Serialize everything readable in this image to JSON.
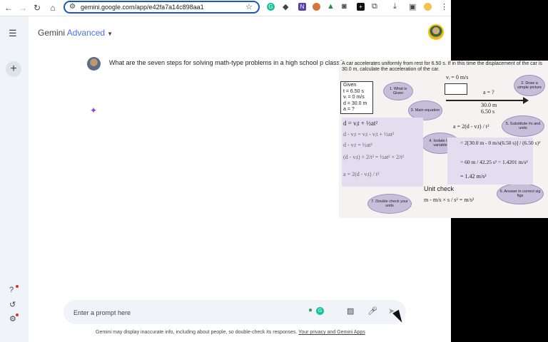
{
  "browser": {
    "url": "gemini.google.com/app/e42fa7a14c898aa1",
    "nav": {
      "back": "←",
      "forward": "→",
      "reload": "↻",
      "home": "⌂"
    },
    "icons": [
      "tune-icon",
      "bookmark-star-icon",
      "grammarly-extension-icon",
      "dropbox-icon",
      "onenote-icon",
      "avatar-extension-icon",
      "google-drive-icon",
      "camera-icon",
      "puzzle-extension-icon",
      "extensions-icon",
      "download-icon",
      "side-panel-icon",
      "profile-icon",
      "more-icon"
    ]
  },
  "app": {
    "brand_name": "Gemini",
    "brand_tier": "Advanced",
    "user_question": "What are the seven steps for solving math-type problems in a high school p class?",
    "prompt_placeholder": "Enter a prompt here",
    "disclaimer": "Gemini may display inaccurate info, including about people, so double-check its responses.",
    "disclaimer_link": "Your privacy and Gemini Apps"
  },
  "math_image": {
    "problem": "A car accelerates uniformly from rest for 6.50 s. If in this time the displacement of the car is 30.0 m, calculate the acceleration of the car.",
    "given_title": "Given",
    "given": [
      "t = 6.50 s",
      "vᵢ = 0 m/s",
      "d = 30.0 m",
      "a = ?"
    ],
    "vi_label": "vᵢ = 0 m/s",
    "a_label": "a = ?",
    "d_label": "30.0 m",
    "t_label": "6.50 s",
    "steps": {
      "s1": "1. What is Given",
      "s2": "2. Draw a simple picture",
      "s3": "3. Main equation",
      "s4": "4. Isolate the variable",
      "s5": "5. Substitute #s and units",
      "s6": "6. Answer in correct sig figs",
      "s7": "7. Double check your units"
    },
    "equations": {
      "main": "d = vᵢt + ½at²",
      "iso1": "d - vᵢt = vᵢt - vᵢt + ½at²",
      "iso2": "d - vᵢt = ½at²",
      "iso3": "(d - vᵢt) × 2/t² = ½at² × 2/t²",
      "iso4": "a = 2(d - vᵢt) / t²",
      "sub1": "a = 2(d - vᵢt) / t²",
      "sub2": "= 2[30.0 m - 0 m/s(6.50 s)] / (6.50 s)²",
      "sub3": "= 60 m / 42.25 s² = 1.4201 m/s²",
      "sub4": "= 1.42 m/s²"
    },
    "unit_check_title": "Unit check",
    "unit_check": "m - m/s × s  /  s²  =  m/s²"
  }
}
